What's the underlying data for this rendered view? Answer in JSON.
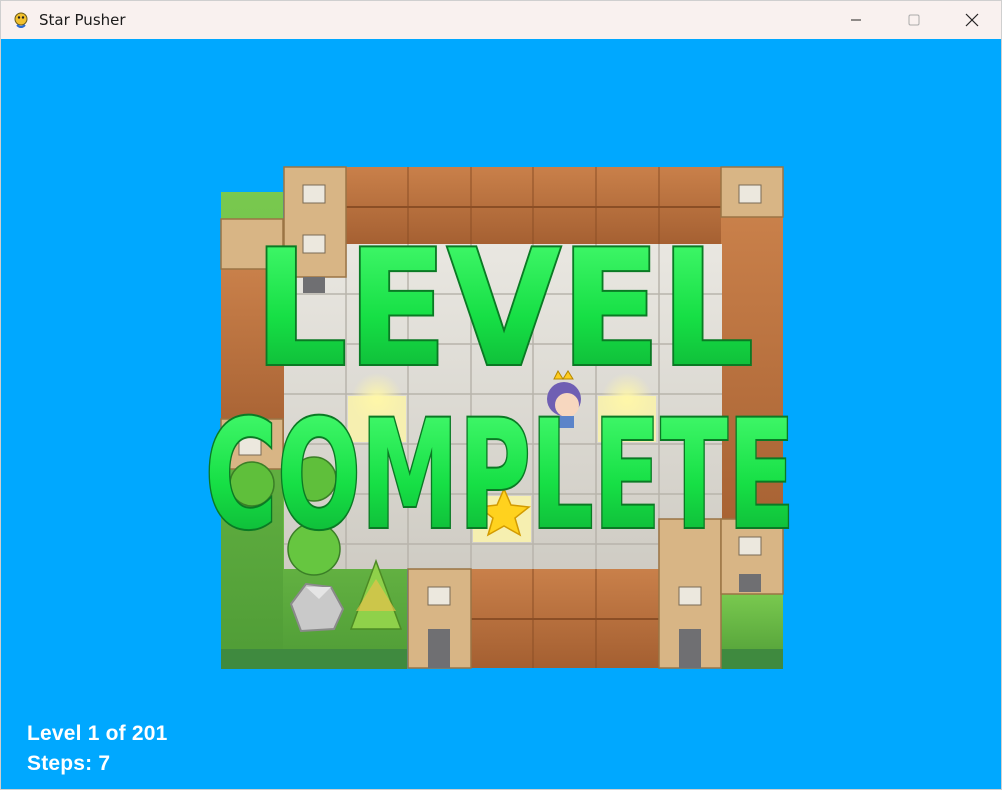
{
  "window": {
    "title": "Star Pusher",
    "controls": [
      "minimize-icon",
      "maximize-icon",
      "close-icon"
    ]
  },
  "game": {
    "background_color": "#00a8ff",
    "overlay_text_line1": "LEVEL",
    "overlay_text_line2": "COMPLETE",
    "overlay_color": "#18e04a"
  },
  "hud": {
    "level_text": "Level 1 of 201",
    "steps_text": "Steps: 7"
  }
}
